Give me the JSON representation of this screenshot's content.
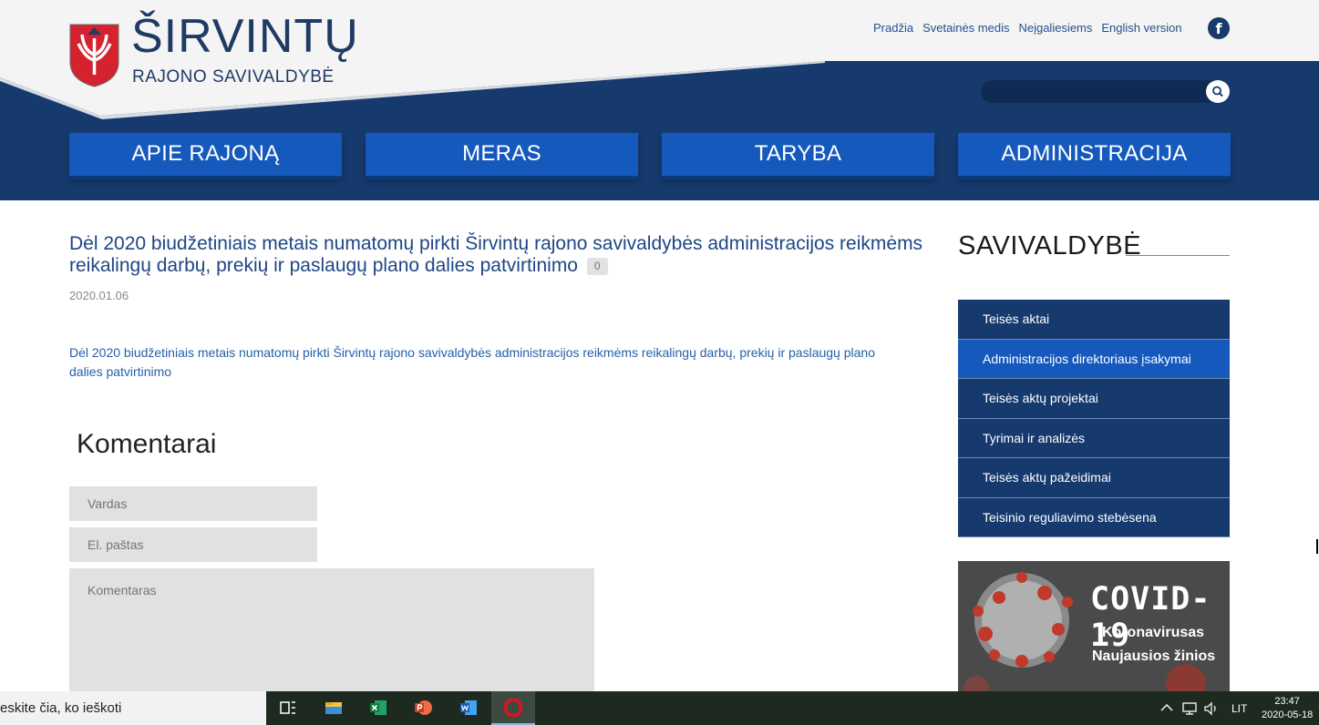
{
  "header": {
    "logo_title": "ŠIRVINTŲ",
    "logo_subtitle": "RAJONO SAVIVALDYBĖ",
    "top_links": [
      "Pradžia",
      "Svetainės medis",
      "Neįgaliesiems",
      "English version"
    ],
    "facebook_glyph": "f",
    "search": {
      "placeholder": ""
    },
    "nav": [
      "APIE RAJONĄ",
      "MERAS",
      "TARYBA",
      "ADMINISTRACIJA"
    ]
  },
  "article": {
    "title": "Dėl 2020 biudžetiniais metais numatomų pirkti Širvintų rajono savivaldybės administracijos reikmėms reikalingų darbų, prekių ir paslaugų plano dalies patvirtinimo",
    "comment_count": "0",
    "date": "2020.01.06",
    "link_text": "Dėl 2020 biudžetiniais metais numatomų pirkti Širvintų rajono savivaldybės administracijos reikmėms reikalingų darbų, prekių ir paslaugų plano dalies patvirtinimo"
  },
  "comments": {
    "heading": "Komentarai",
    "name_placeholder": "Vardas",
    "email_placeholder": "El. paštas",
    "comment_placeholder": "Komentaras"
  },
  "sidebar": {
    "heading": "SAVIVALDYBĖ",
    "items": [
      {
        "label": "Teisės aktai",
        "active": false
      },
      {
        "label": "Administracijos direktoriaus įsakymai",
        "active": true
      },
      {
        "label": "Teisės aktų projektai",
        "active": false
      },
      {
        "label": "Tyrimai ir analizės",
        "active": false
      },
      {
        "label": "Teisės aktų pažeidimai",
        "active": false
      },
      {
        "label": "Teisinio reguliavimo stebėsena",
        "active": false
      }
    ],
    "covid_banner": {
      "title": "COVID-19",
      "line1": "Koronavirusas",
      "line2": "Naujausios žinios"
    }
  },
  "taskbar": {
    "search_text": "eskite čia, ko ieškoti",
    "apps": [
      "task-view-icon",
      "file-explorer-icon",
      "excel-icon",
      "powerpoint-icon",
      "word-icon",
      "opera-icon"
    ],
    "language": "LIT",
    "time": "23:47",
    "date": "2020-05-18"
  },
  "colors": {
    "header_blue": "#163a6e",
    "nav_blue": "#1659bd",
    "link_blue": "#2660a8"
  }
}
